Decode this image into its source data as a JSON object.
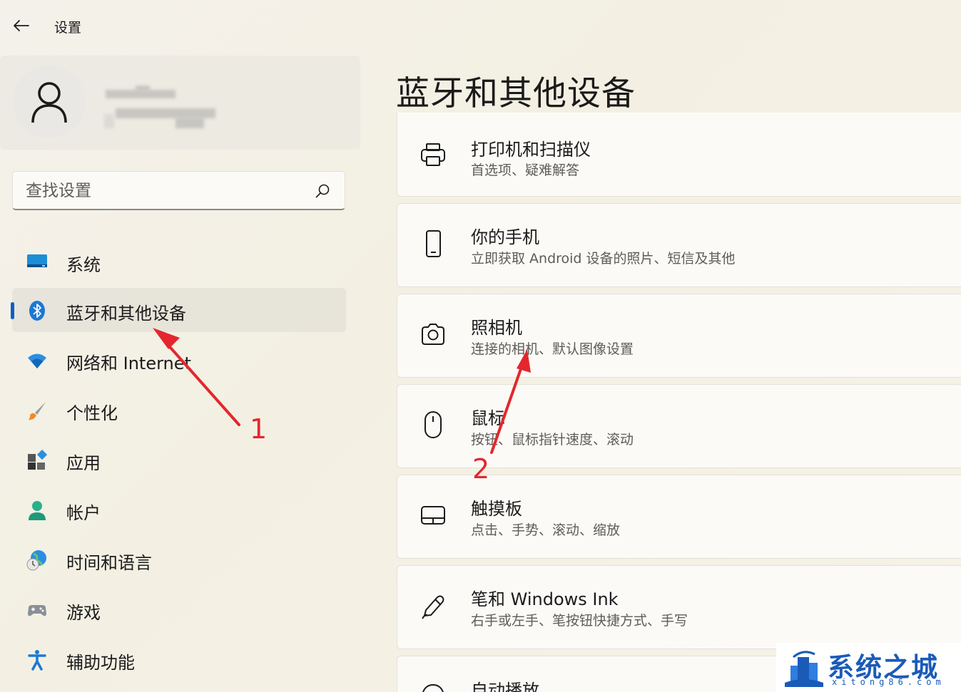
{
  "titlebar": {
    "title": "设置"
  },
  "search": {
    "placeholder": "查找设置"
  },
  "sidebar": {
    "items": [
      {
        "label": "系统",
        "icon": "monitor-icon"
      },
      {
        "label": "蓝牙和其他设备",
        "icon": "bluetooth-icon",
        "active": true
      },
      {
        "label": "网络和 Internet",
        "icon": "wifi-icon"
      },
      {
        "label": "个性化",
        "icon": "brush-icon"
      },
      {
        "label": "应用",
        "icon": "apps-icon"
      },
      {
        "label": "帐户",
        "icon": "account-icon"
      },
      {
        "label": "时间和语言",
        "icon": "globe-clock-icon"
      },
      {
        "label": "游戏",
        "icon": "gamepad-icon"
      },
      {
        "label": "辅助功能",
        "icon": "accessibility-icon"
      }
    ]
  },
  "main": {
    "title": "蓝牙和其他设备",
    "cards": [
      {
        "title": "打印机和扫描仪",
        "subtitle": "首选项、疑难解答",
        "icon": "printer-icon"
      },
      {
        "title": "你的手机",
        "subtitle": "立即获取 Android 设备的照片、短信及其他",
        "icon": "phone-icon"
      },
      {
        "title": "照相机",
        "subtitle": "连接的相机、默认图像设置",
        "icon": "camera-icon"
      },
      {
        "title": "鼠标",
        "subtitle": "按钮、鼠标指针速度、滚动",
        "icon": "mouse-icon"
      },
      {
        "title": "触摸板",
        "subtitle": "点击、手势、滚动、缩放",
        "icon": "touchpad-icon"
      },
      {
        "title": "笔和 Windows Ink",
        "subtitle": "右手或左手、笔按钮快捷方式、手写",
        "icon": "pen-icon"
      },
      {
        "title": "自动播放",
        "subtitle": "",
        "icon": "autoplay-icon"
      }
    ]
  },
  "annotations": {
    "arrow1_label": "1",
    "arrow2_label": "2",
    "color": "#e3272d"
  },
  "watermark": {
    "text": "系统之城",
    "sub": "xitong86.com"
  },
  "colors": {
    "accent": "#0a5fc4"
  }
}
